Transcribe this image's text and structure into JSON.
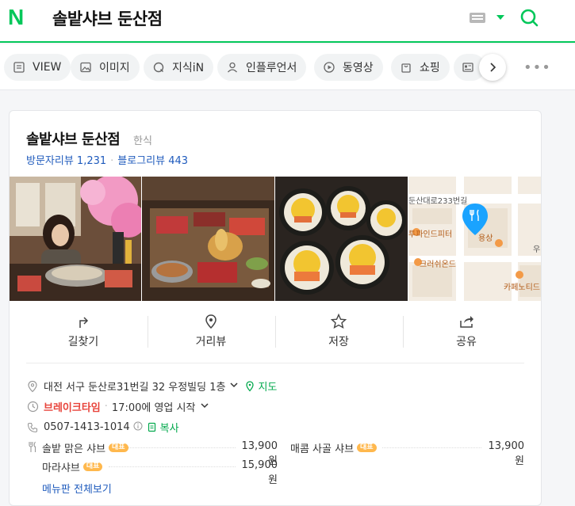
{
  "header": {
    "logo": "N",
    "query": "솔밭샤브 둔산점"
  },
  "tabs": [
    {
      "label": "VIEW",
      "icon": "view-icon"
    },
    {
      "label": "이미지",
      "icon": "image-icon"
    },
    {
      "label": "지식iN",
      "icon": "qna-icon"
    },
    {
      "label": "인플루언서",
      "icon": "person-icon"
    },
    {
      "label": "동영상",
      "icon": "play-icon"
    },
    {
      "label": "쇼핑",
      "icon": "shopping-bag-icon"
    },
    {
      "label": "",
      "icon": "news-icon"
    }
  ],
  "place": {
    "name": "솔밭샤브 둔산점",
    "category": "한식",
    "visitor_reviews": "방문자리뷰 1,231",
    "blog_reviews": "블로그리뷰 443"
  },
  "map": {
    "street_label": "둔산대로233번길",
    "pois": [
      "투파인드피터",
      "크러쉬온드",
      "카페노티드",
      "용상",
      "우"
    ],
    "accent": "#1aa3ff"
  },
  "actions": [
    {
      "label": "길찾기",
      "icon": "directions-icon"
    },
    {
      "label": "거리뷰",
      "icon": "street-view-icon"
    },
    {
      "label": "저장",
      "icon": "star-icon"
    },
    {
      "label": "공유",
      "icon": "share-icon"
    }
  ],
  "info": {
    "address": "대전 서구 둔산로31번길 32 우정빌딩 1층",
    "map_link": "지도",
    "status": "브레이크타임",
    "hours": "17:00에 영업 시작",
    "phone": "0507-1413-1014",
    "copy": "복사"
  },
  "menu": {
    "items": [
      {
        "name": "솔밭 맑은 샤브",
        "badge": "대표",
        "price": "13,900원"
      },
      {
        "name": "매콤 사골 샤브",
        "badge": "대표",
        "price": "13,900원"
      },
      {
        "name": "마라샤브",
        "badge": "대표",
        "price": "15,900원"
      }
    ],
    "more": "메뉴판 전체보기"
  },
  "colors": {
    "brand": "#03c75a",
    "link": "#1f5bbd",
    "break_time": "#e8443b"
  }
}
